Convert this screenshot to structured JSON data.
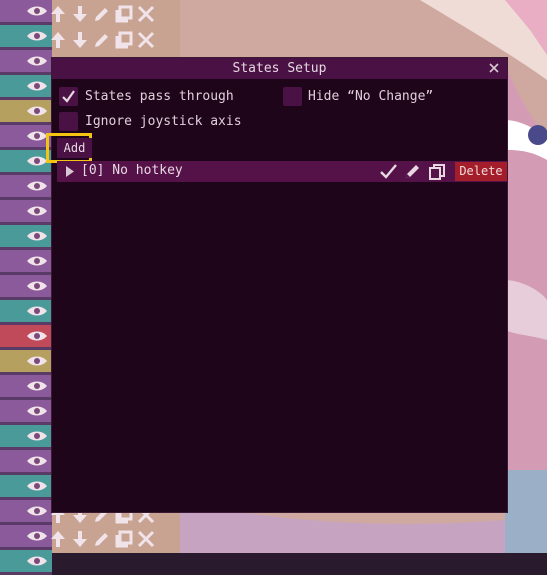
{
  "dialog": {
    "title": "States Setup",
    "options": {
      "states_pass_through": {
        "label": "States pass through",
        "checked": true
      },
      "hide_no_change": {
        "label": "Hide “No Change”",
        "checked": false
      },
      "ignore_joystick_axis": {
        "label": "Ignore joystick axis",
        "checked": false
      }
    },
    "add_label": "Add",
    "hotkeys": [
      {
        "label": "[0] No hotkey",
        "delete_label": "Delete"
      }
    ]
  },
  "colors": {
    "dialog_bg": "#1e0519",
    "titlebar": "#4a1244",
    "row_bg": "#551249",
    "delete": "#a31d2b",
    "highlight": "#f4c414"
  }
}
